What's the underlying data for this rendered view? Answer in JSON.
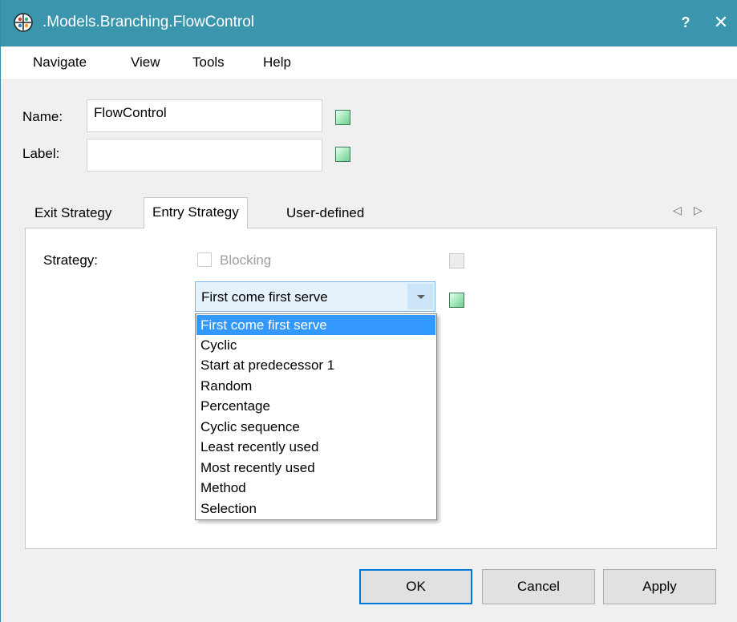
{
  "window": {
    "title": ".Models.Branching.FlowControl",
    "help_label": "?",
    "close_label": "✕",
    "icon": "app-logo-icon"
  },
  "menu": {
    "items": [
      "Navigate",
      "View",
      "Tools",
      "Help"
    ]
  },
  "form": {
    "name_label": "Name:",
    "name_value": "FlowControl",
    "label_label": "Label:",
    "label_value": ""
  },
  "tabs": {
    "items": [
      "Exit Strategy",
      "Entry Strategy",
      "User-defined"
    ],
    "active": "Entry Strategy",
    "scroll_left_icon": "◁",
    "scroll_right_icon": "▷"
  },
  "entry_strategy": {
    "strategy_label": "Strategy:",
    "blocking_label": "Blocking",
    "blocking_checked": false,
    "blocking_enabled": false,
    "selected": "First come first serve",
    "options": [
      "First come first serve",
      "Cyclic",
      "Start at predecessor 1",
      "Random",
      "Percentage",
      "Cyclic sequence",
      "Least recently used",
      "Most recently used",
      "Method",
      "Selection"
    ]
  },
  "buttons": {
    "ok": "OK",
    "cancel": "Cancel",
    "apply": "Apply"
  },
  "colors": {
    "titlebar": "#3a95ad",
    "selection": "#3399ff",
    "status_green": "#9fe6b8"
  }
}
